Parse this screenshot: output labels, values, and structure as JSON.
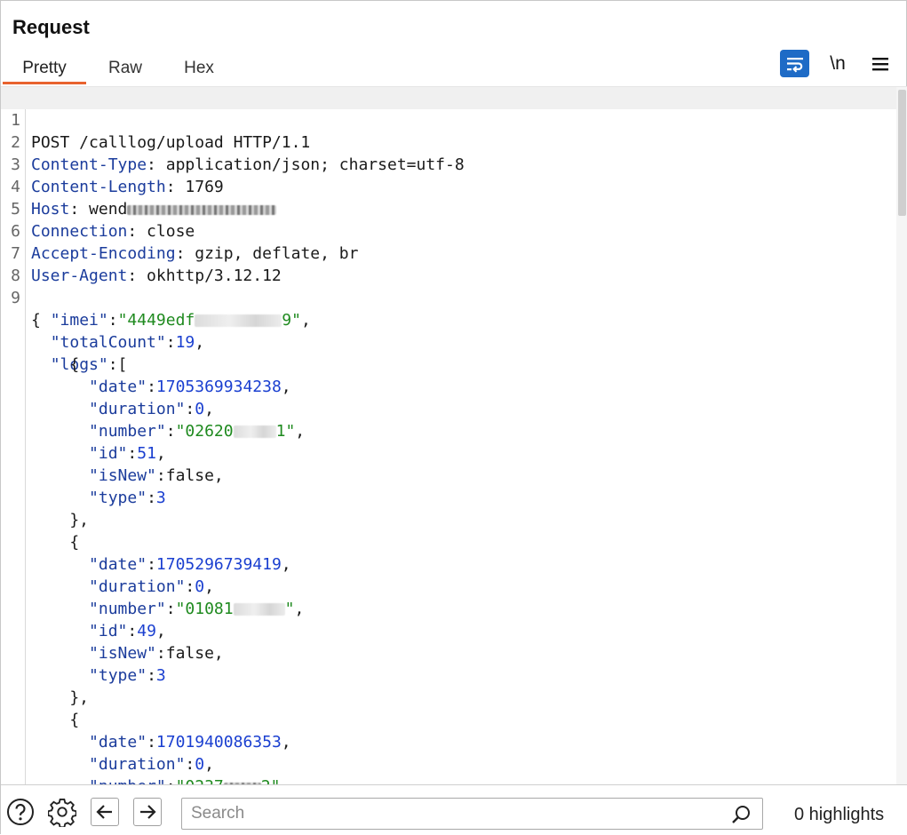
{
  "panel": {
    "title": "Request"
  },
  "tabs": [
    {
      "label": "Pretty",
      "active": true
    },
    {
      "label": "Raw",
      "active": false
    },
    {
      "label": "Hex",
      "active": false
    }
  ],
  "toolbar": {
    "wrap_icon": "word-wrap-icon",
    "newline_label": "\\n",
    "menu_icon": "hamburger-menu-icon",
    "accent_color": "#1e6bc6"
  },
  "editor": {
    "request_line": "POST /calllog/upload HTTP/1.1",
    "headers": [
      {
        "name": "Content-Type",
        "value": " application/json; charset=utf-8"
      },
      {
        "name": "Content-Length",
        "value": " 1769"
      },
      {
        "name": "Host",
        "value": " wend"
      },
      {
        "name": "Connection",
        "value": " close"
      },
      {
        "name": "Accept-Encoding",
        "value": " gzip, deflate, br"
      },
      {
        "name": "User-Agent",
        "value": " okhttp/3.12.12"
      }
    ],
    "line_numbers": [
      "1",
      "2",
      "3",
      "4",
      "5",
      "6",
      "7",
      "8",
      "9"
    ],
    "body": {
      "imei_prefix": "4449edf",
      "imei_suffix": "9",
      "totalCount": "19",
      "logs": [
        {
          "date": "1705369934238",
          "duration": "0",
          "number_prefix": "02620",
          "number_suffix": "1",
          "id": "51",
          "isNew": "false",
          "type": "3"
        },
        {
          "date": "1705296739419",
          "duration": "0",
          "number_prefix": "01081",
          "number_suffix": "",
          "id": "49",
          "isNew": "false",
          "type": "3"
        },
        {
          "date": "1701940086353",
          "duration": "0",
          "number_prefix": "0237",
          "number_suffix": "2"
        }
      ]
    }
  },
  "footer": {
    "help_icon": "help-circle-icon",
    "settings_icon": "gear-icon",
    "back_icon": "arrow-left-icon",
    "forward_icon": "arrow-right-icon",
    "search_placeholder": "Search",
    "search_icon": "search-icon",
    "highlights_text": "0 highlights"
  }
}
